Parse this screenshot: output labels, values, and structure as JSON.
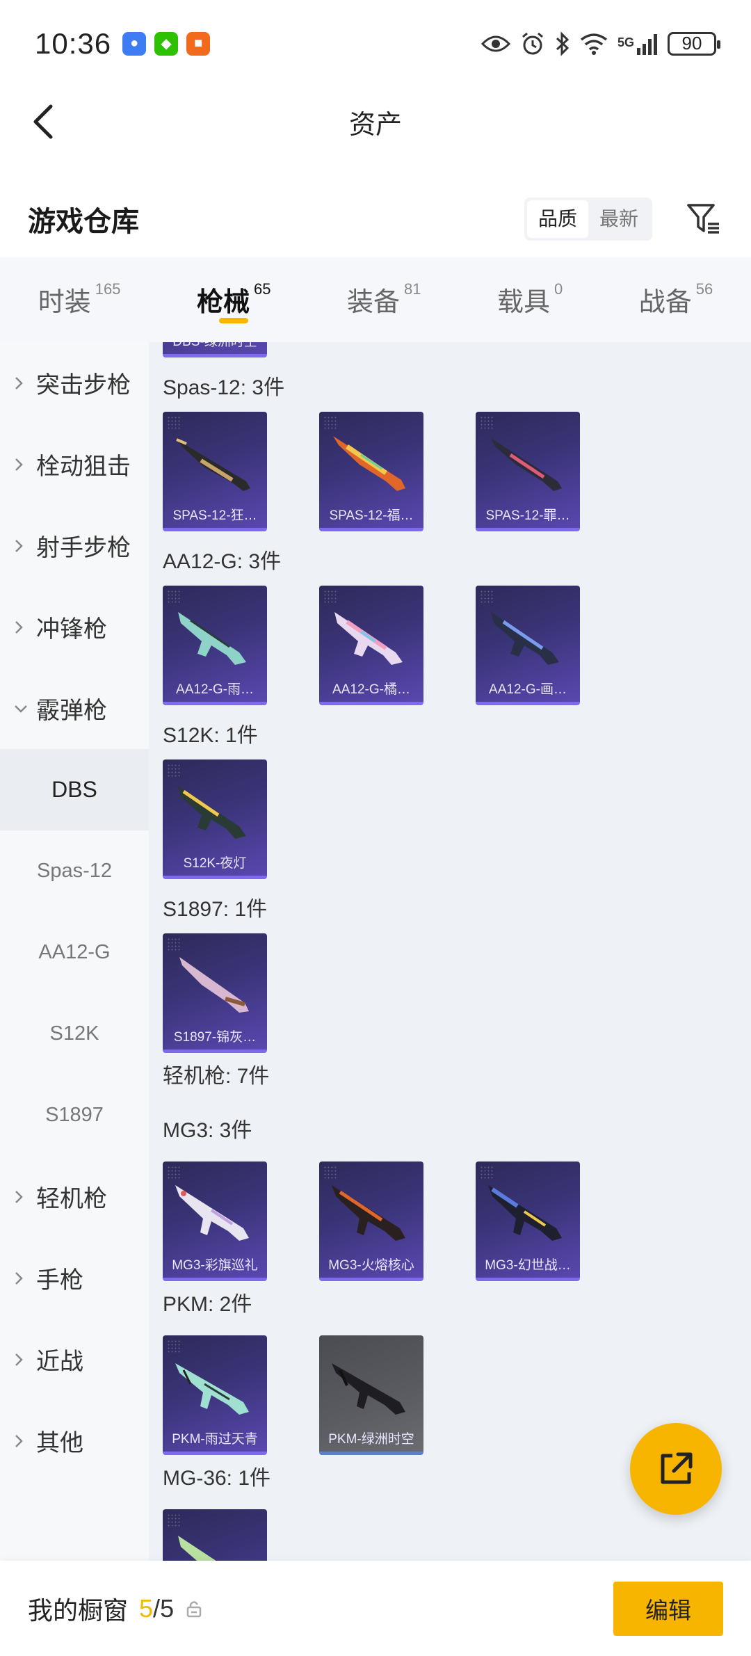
{
  "status_bar": {
    "time": "10:36",
    "battery": "90",
    "network": "5G",
    "apps": [
      {
        "icon": "app-blue-icon",
        "color": "#3d7cf2"
      },
      {
        "icon": "wechat-icon",
        "color": "#2dc100"
      },
      {
        "icon": "app-orange-icon",
        "color": "#f26b1d"
      }
    ]
  },
  "nav": {
    "title": "资产"
  },
  "warehouse": {
    "title": "游戏仓库",
    "sort_options": [
      {
        "label": "品质",
        "active": true
      },
      {
        "label": "最新",
        "active": false
      }
    ]
  },
  "tabs": [
    {
      "label": "时装",
      "count": "165"
    },
    {
      "label": "枪械",
      "count": "65",
      "active": true
    },
    {
      "label": "装备",
      "count": "81"
    },
    {
      "label": "载具",
      "count": "0"
    },
    {
      "label": "战备",
      "count": "56"
    }
  ],
  "sidebar": {
    "categories": [
      {
        "label": "突击步枪"
      },
      {
        "label": "栓动狙击"
      },
      {
        "label": "射手步枪"
      },
      {
        "label": "冲锋枪"
      },
      {
        "label": "霰弹枪",
        "expanded": true
      },
      {
        "label": "轻机枪"
      },
      {
        "label": "手枪"
      },
      {
        "label": "近战"
      },
      {
        "label": "其他"
      }
    ],
    "shotgun_subs": [
      "DBS",
      "Spas-12",
      "AA12-G",
      "S12K",
      "S1897"
    ],
    "active_sub": "DBS"
  },
  "content": {
    "top_partial_label": "DBS-绿洲时空",
    "groups": [
      {
        "heading": "Spas-12: 3件",
        "items": [
          "SPAS-12-狂…",
          "SPAS-12-福…",
          "SPAS-12-罪…"
        ]
      },
      {
        "heading": "AA12-G: 3件",
        "items": [
          "AA12-G-雨…",
          "AA12-G-橘…",
          "AA12-G-画…"
        ]
      },
      {
        "heading": "S12K: 1件",
        "items": [
          "S12K-夜灯"
        ]
      },
      {
        "heading": "S1897: 1件",
        "items": [
          "S1897-锦灰…"
        ]
      },
      {
        "heading": "轻机枪: 7件",
        "items": []
      },
      {
        "heading": "MG3: 3件",
        "items": [
          "MG3-彩旗巡礼",
          "MG3-火熔核心",
          "MG3-幻世战…"
        ]
      },
      {
        "heading": "PKM: 2件",
        "items": [
          "PKM-雨过天青",
          "PKM-绿洲时空"
        ]
      },
      {
        "heading": "MG-36: 1件",
        "items": [
          ""
        ]
      }
    ]
  },
  "bottom": {
    "label": "我的橱窗",
    "current": "5",
    "separator": "/",
    "max": "5",
    "edit_label": "编辑"
  },
  "colors": {
    "accent": "#f7b500",
    "card_purple": "#3a3478",
    "card_grey": "#5a5c62"
  }
}
